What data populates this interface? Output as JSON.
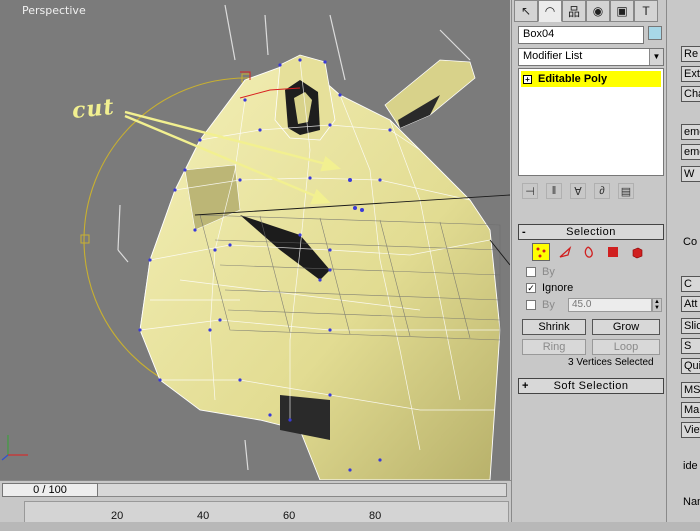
{
  "viewport": {
    "label": "Perspective",
    "annotation": "cut"
  },
  "command_panel": {
    "tabs": [
      "create-icon",
      "modify-icon",
      "hierarchy-icon",
      "motion-icon",
      "display-icon",
      "utilities-icon"
    ],
    "tab_glyphs": [
      "↖",
      "◠",
      "品",
      "◉",
      "▣",
      "T"
    ],
    "object_name": "Box04",
    "object_color": "#a8d8e8",
    "modifier_list": "Modifier List",
    "stack": [
      {
        "label": "Editable Poly"
      }
    ],
    "selection": {
      "title": "Selection",
      "by_vertex": "By",
      "ignore_backfacing": "Ignore",
      "by_angle": "By",
      "angle_value": "45.0",
      "shrink": "Shrink",
      "grow": "Grow",
      "ring": "Ring",
      "loop": "Loop",
      "status": "3 Vertices Selected"
    },
    "soft_selection": {
      "title": "Soft Selection"
    }
  },
  "right_panel": {
    "labels": [
      "Re",
      "Ext",
      "Cha",
      "emov",
      "emov",
      "W",
      "Co",
      "C",
      "Att",
      "Slic",
      "S",
      "Quic",
      "MSm",
      "Make",
      "View",
      "ide",
      "Nam"
    ]
  },
  "timeline": {
    "frame_display": "0 / 100",
    "ticks": [
      "20",
      "40",
      "60",
      "80"
    ]
  },
  "colors": {
    "accent_yellow": "#ffff00",
    "mesh": "#e8e39a",
    "annotation": "#f2f090",
    "vertex": "#3a3ad8"
  }
}
